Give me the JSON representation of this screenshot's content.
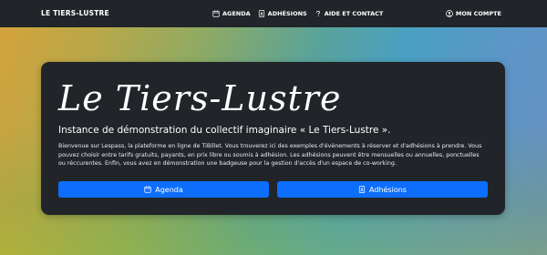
{
  "navbar": {
    "brand": "LE TIERS-LUSTRE",
    "items": [
      {
        "label": "AGENDA",
        "icon": "calendar-icon"
      },
      {
        "label": "ADHÉSIONS",
        "icon": "id-card-icon"
      },
      {
        "label": "AIDE ET CONTACT",
        "icon": "question-icon"
      }
    ],
    "account": {
      "label": "MON COMPTE",
      "icon": "user-circle-icon"
    }
  },
  "hero": {
    "title": "Le Tiers-Lustre",
    "subtitle": "Instance de démonstration du collectif imaginaire « Le Tiers-Lustre ».",
    "description": "Bienvenue sur Lespass, la plateforme en ligne de TiBillet. Vous trouverez ici des exemples d'évènements à réserver et d'adhésions à prendre. Vous pouvez choisir entre tarifs gratuits, payants, en prix libre ou soumis à adhésion. Les adhésions peuvent être mensuelles ou annuelles, ponctuelles ou réccurentes. Enfin, vous avez en démonstration une badgeuse pour la gestion d'accès d'un espace de co-working.",
    "buttons": [
      {
        "label": "Agenda",
        "icon": "calendar-icon"
      },
      {
        "label": "Adhésions",
        "icon": "id-card-icon"
      }
    ]
  },
  "colors": {
    "navbar_bg": "#212529",
    "card_bg": "#212529",
    "button_bg": "#0d6efd"
  }
}
